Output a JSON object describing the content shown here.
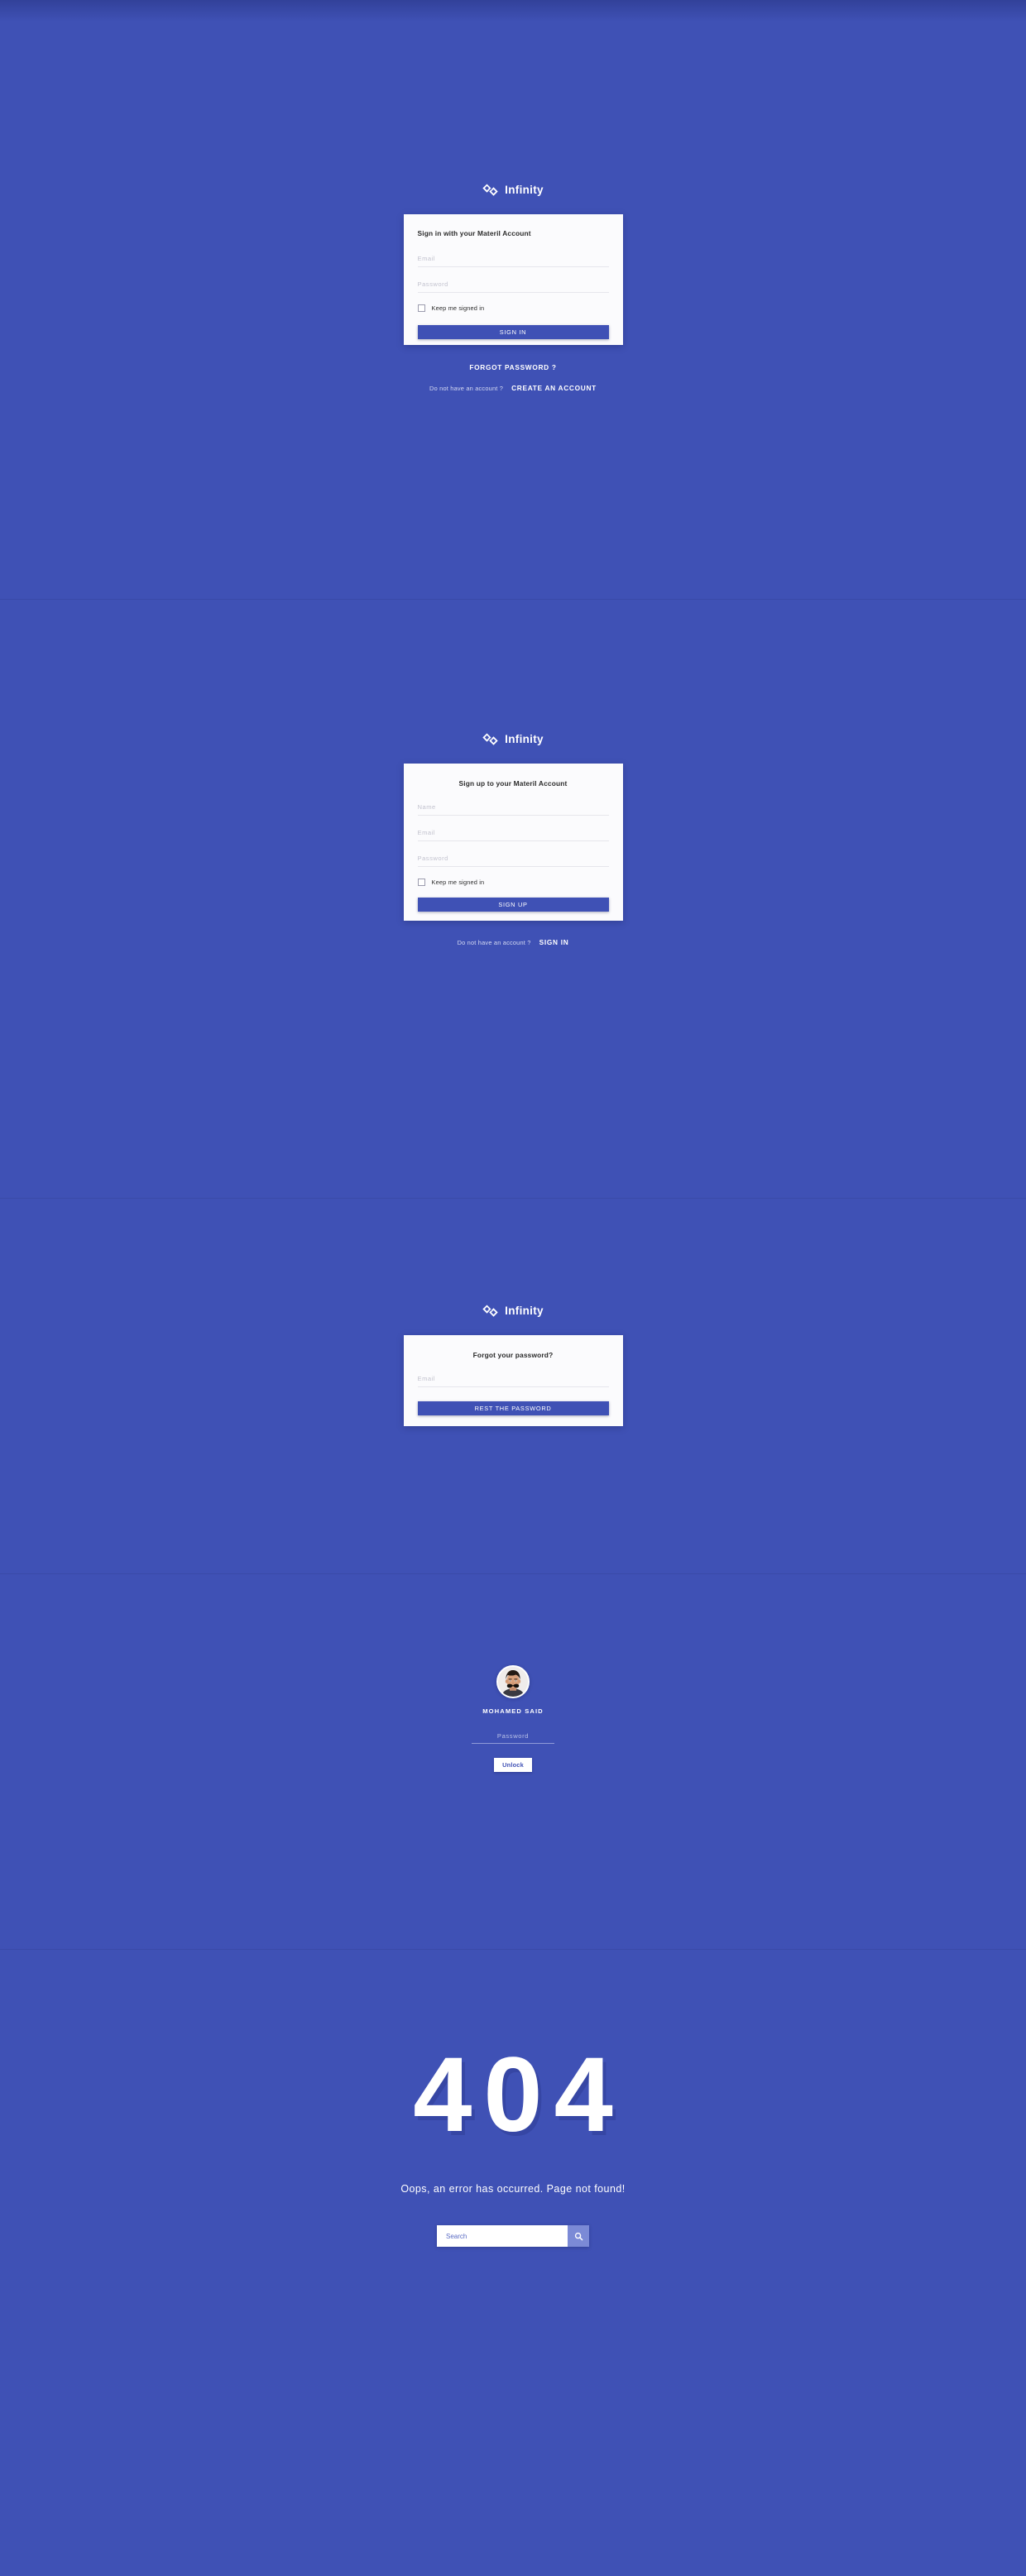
{
  "theme": {
    "background": "#3f51b5",
    "card_background": "#fbfbfd",
    "accent": "#3f51b5",
    "text_on_accent": "#ffffff",
    "search_button": "#7b8ad6"
  },
  "brand": {
    "name": "Infinity",
    "logo_icon": "infinity-diamond-icon"
  },
  "signin": {
    "title": "Sign in with your Materil Account",
    "email_placeholder": "Email",
    "email_value": "",
    "password_placeholder": "Password",
    "password_value": "",
    "keep_signed_label": "Keep me signed in",
    "submit_label": "SIGN IN",
    "forgot_label": "FORGOT PASSWORD ?",
    "no_account_text": "Do not have an account ?",
    "create_account_label": "CREATE AN ACCOUNT"
  },
  "signup": {
    "title": "Sign up to your Materil Account",
    "name_placeholder": "Name",
    "name_value": "",
    "email_placeholder": "Email",
    "email_value": "",
    "password_placeholder": "Password",
    "password_value": "",
    "keep_signed_label": "Keep me signed in",
    "submit_label": "SIGN UP",
    "have_account_text": "Do not have an account ?",
    "signin_label": "SIGN IN"
  },
  "forgot": {
    "title": "Forgot your password?",
    "email_placeholder": "Email",
    "email_value": "",
    "submit_label": "REST THE PASSWORD"
  },
  "lock": {
    "user_name": "MOHAMED SAID",
    "avatar_alt": "user-avatar",
    "password_placeholder": "Password",
    "password_value": "",
    "unlock_label": "Unlock"
  },
  "error": {
    "code": "404",
    "message": "Oops, an error has occurred. Page not found!",
    "search_placeholder": "Search",
    "search_value": "",
    "search_icon": "magnifier-icon"
  }
}
